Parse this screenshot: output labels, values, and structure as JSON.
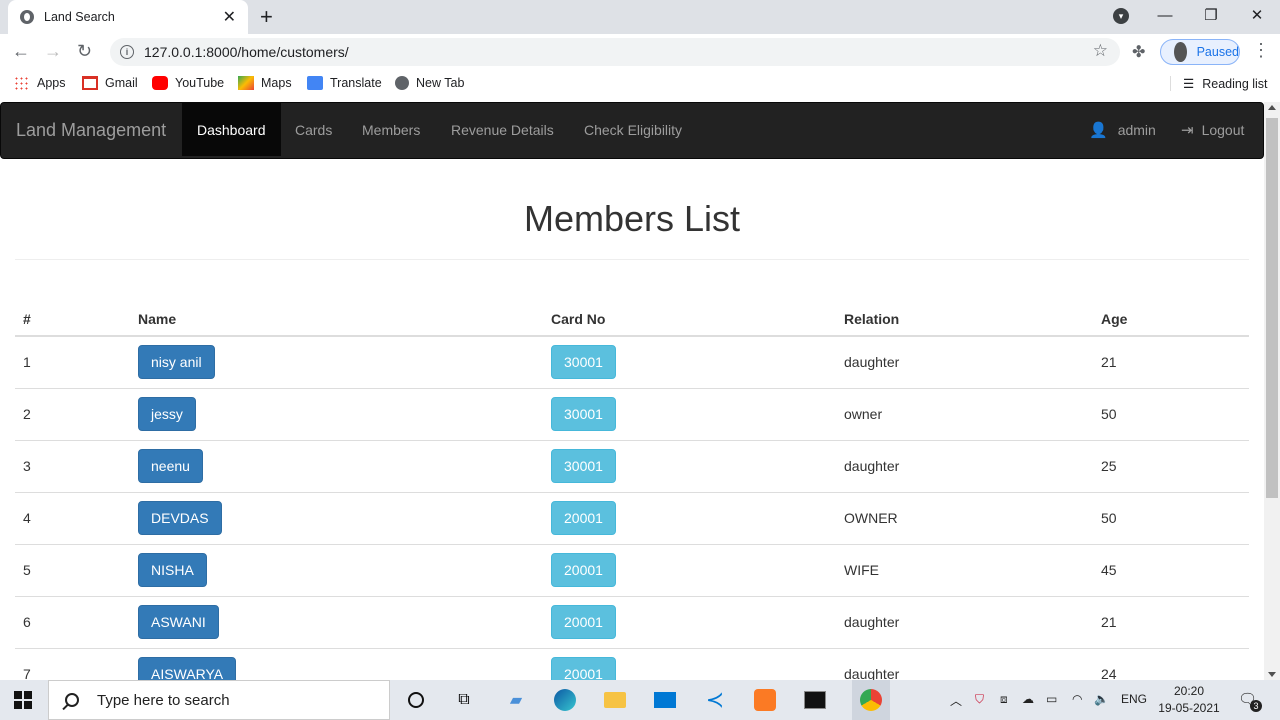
{
  "browser": {
    "tab_title": "Land Search",
    "url": "127.0.0.1:8000/home/customers/",
    "profile_status": "Paused",
    "bookmarks": [
      "Apps",
      "Gmail",
      "YouTube",
      "Maps",
      "Translate",
      "New Tab"
    ],
    "reading_list": "Reading list"
  },
  "navbar": {
    "brand": "Land Management",
    "links": [
      "Dashboard",
      "Cards",
      "Members",
      "Revenue Details",
      "Check Eligibility"
    ],
    "user": "admin",
    "logout": "Logout"
  },
  "page": {
    "title": "Members List",
    "columns": [
      "#",
      "Name",
      "Card No",
      "Relation",
      "Age"
    ],
    "rows": [
      {
        "num": "1",
        "name": "nisy anil",
        "card": "30001",
        "relation": "daughter",
        "age": "21"
      },
      {
        "num": "2",
        "name": "jessy",
        "card": "30001",
        "relation": "owner",
        "age": "50"
      },
      {
        "num": "3",
        "name": "neenu",
        "card": "30001",
        "relation": "daughter",
        "age": "25"
      },
      {
        "num": "4",
        "name": "DEVDAS",
        "card": "20001",
        "relation": "OWNER",
        "age": "50"
      },
      {
        "num": "5",
        "name": "NISHA",
        "card": "20001",
        "relation": "WIFE",
        "age": "45"
      },
      {
        "num": "6",
        "name": "ASWANI",
        "card": "20001",
        "relation": "daughter",
        "age": "21"
      },
      {
        "num": "7",
        "name": "AISWARYA",
        "card": "20001",
        "relation": "daughter",
        "age": "24"
      }
    ]
  },
  "taskbar": {
    "search_placeholder": "Type here to search",
    "language": "ENG",
    "time": "20:20",
    "date": "19-05-2021",
    "notification_count": "3"
  },
  "colors": {
    "navbar_bg": "#222222",
    "btn_primary": "#337ab7",
    "btn_info": "#5bc0de"
  }
}
